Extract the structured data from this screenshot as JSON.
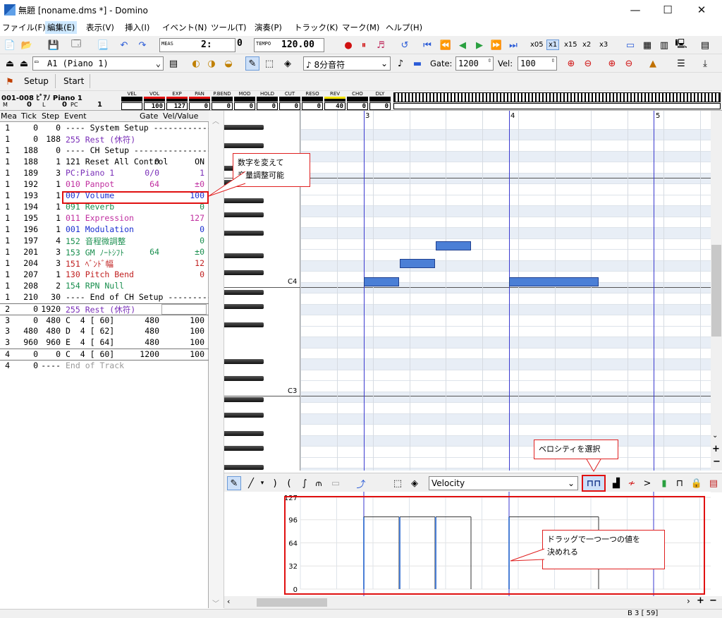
{
  "window": {
    "title": "無題 [noname.dms *] - Domino",
    "minimize": "—",
    "maximize": "☐",
    "close": "✕"
  },
  "menu": [
    "ファイル(F)",
    "編集(E)",
    "表示(V)",
    "挿入(I)",
    "イベント(N)",
    "ツール(T)",
    "演奏(P)",
    "トラック(K)",
    "マーク(M)",
    "ヘルプ(H)"
  ],
  "toolbar1": {
    "meas_label": "MEAS",
    "meas_value": "2:",
    "tick_value": "0",
    "tempo_label": "TEMPO",
    "tempo_value": "120.00",
    "speed": [
      "x05",
      "x1",
      "x15",
      "x2",
      "x3"
    ]
  },
  "toolbar2": {
    "track": "A1 (Piano 1)",
    "note_length": "♪ 8分音符",
    "gate_label": "Gate:",
    "gate_value": "1200",
    "vel_label": "Vel:",
    "vel_value": "100"
  },
  "toolbar3": {
    "setup": "Setup",
    "start": "Start"
  },
  "track_info": {
    "name": "001-008 ﾋﾟｱﾉ Piano 1",
    "m_label": "M",
    "m_value": "0",
    "l_label": "L",
    "l_value": "0",
    "pc_label": "PC",
    "pc_value": "1",
    "cc_labels": [
      "VEL",
      "VOL",
      "EXP",
      "PAN",
      "P.BEND",
      "MOD",
      "HOLD",
      "CUT",
      "RESO",
      "REV",
      "CHO",
      "DLY"
    ],
    "cc_values": [
      "",
      "100",
      "127",
      "0",
      "0",
      "0",
      "0",
      "0",
      "0",
      "40",
      "0",
      "0"
    ]
  },
  "event_headers": [
    "Mea",
    "Tick",
    "Step",
    "Event",
    "Gate",
    "Vel/Value"
  ],
  "events": [
    {
      "mea": "1",
      "tick": "0",
      "step": "0",
      "event": "---- System Setup -------------",
      "gate": "",
      "val": "",
      "color": "#000"
    },
    {
      "mea": "1",
      "tick": "0",
      "step": "188",
      "event": "255 Rest (休符)",
      "gate": "",
      "val": "",
      "color": "#7a2fb8"
    },
    {
      "mea": "1",
      "tick": "188",
      "step": "0",
      "event": "---- CH Setup -----------------",
      "gate": "",
      "val": "",
      "color": "#000"
    },
    {
      "mea": "1",
      "tick": "188",
      "step": "1",
      "event": "121 Reset All Control",
      "gate": "0",
      "val": "ON",
      "color": "#000"
    },
    {
      "mea": "1",
      "tick": "189",
      "step": "3",
      "event": "PC:Piano 1",
      "gate": "0/0",
      "val": "1",
      "color": "#7a2fb8"
    },
    {
      "mea": "1",
      "tick": "192",
      "step": "1",
      "event": "010 Panpot",
      "gate": "64",
      "val": "±0",
      "color": "#c02fa0"
    },
    {
      "mea": "1",
      "tick": "193",
      "step": "1",
      "event": "007 Volume",
      "gate": "",
      "val": "100",
      "color": "#1a2fd0"
    },
    {
      "mea": "1",
      "tick": "194",
      "step": "1",
      "event": "091 Reverb",
      "gate": "",
      "val": "0",
      "color": "#1a8f4f"
    },
    {
      "mea": "1",
      "tick": "195",
      "step": "1",
      "event": "011 Expression",
      "gate": "",
      "val": "127",
      "color": "#c02fa0"
    },
    {
      "mea": "1",
      "tick": "196",
      "step": "1",
      "event": "001 Modulation",
      "gate": "",
      "val": "0",
      "color": "#1a2fd0"
    },
    {
      "mea": "1",
      "tick": "197",
      "step": "4",
      "event": "152 音程微調整",
      "gate": "",
      "val": "0",
      "color": "#1a8f4f"
    },
    {
      "mea": "1",
      "tick": "201",
      "step": "3",
      "event": "153 GM ﾉｰﾄｼﾌﾄ",
      "gate": "64",
      "val": "±0",
      "color": "#1a8f4f"
    },
    {
      "mea": "1",
      "tick": "204",
      "step": "3",
      "event": "151 ﾍﾞﾝﾄﾞ幅",
      "gate": "",
      "val": "12",
      "color": "#c02020"
    },
    {
      "mea": "1",
      "tick": "207",
      "step": "1",
      "event": "130 Pitch Bend",
      "gate": "",
      "val": "0",
      "color": "#c02020"
    },
    {
      "mea": "1",
      "tick": "208",
      "step": "2",
      "event": "154 RPN Null",
      "gate": "",
      "val": "",
      "color": "#1a8f4f"
    },
    {
      "mea": "1",
      "tick": "210",
      "step": "30",
      "event": "---- End of CH Setup ----------",
      "gate": "",
      "val": "",
      "color": "#000"
    },
    {
      "mea": "2",
      "tick": "0",
      "step": "1920",
      "event": "255 Rest (休符)",
      "gate": "",
      "val": "",
      "color": "#7a2fb8"
    },
    {
      "mea": "3",
      "tick": "0",
      "step": "480",
      "event": "C  4 [ 60]",
      "gate": "480",
      "val": "100",
      "color": "#000"
    },
    {
      "mea": "3",
      "tick": "480",
      "step": "480",
      "event": "D  4 [ 62]",
      "gate": "480",
      "val": "100",
      "color": "#000"
    },
    {
      "mea": "3",
      "tick": "960",
      "step": "960",
      "event": "E  4 [ 64]",
      "gate": "480",
      "val": "100",
      "color": "#000"
    },
    {
      "mea": "4",
      "tick": "0",
      "step": "0",
      "event": "C  4 [ 60]",
      "gate": "1200",
      "val": "100",
      "color": "#000"
    },
    {
      "mea": "4",
      "tick": "0",
      "step": "----",
      "event": "End of Track",
      "gate": "",
      "val": "",
      "color": "#999"
    }
  ],
  "roll": {
    "measures": [
      "3",
      "4",
      "5"
    ],
    "c4": "C4",
    "c3": "C3"
  },
  "controller": {
    "type": "Velocity",
    "y_ticks": [
      "127",
      "96",
      "64",
      "32",
      "0"
    ]
  },
  "notes": [
    {
      "name": "C4",
      "vel": 100
    },
    {
      "name": "D4",
      "vel": 100
    },
    {
      "name": "E4",
      "vel": 100
    },
    {
      "name": "C4",
      "vel": 100
    }
  ],
  "callouts": {
    "volume": "数字を変えて\n音量調整可能",
    "velocity_select": "ベロシティを選択",
    "drag": "ドラッグで一つ一つの値を\n決めれる"
  },
  "status": {
    "position": "B 3 [ 59]"
  }
}
